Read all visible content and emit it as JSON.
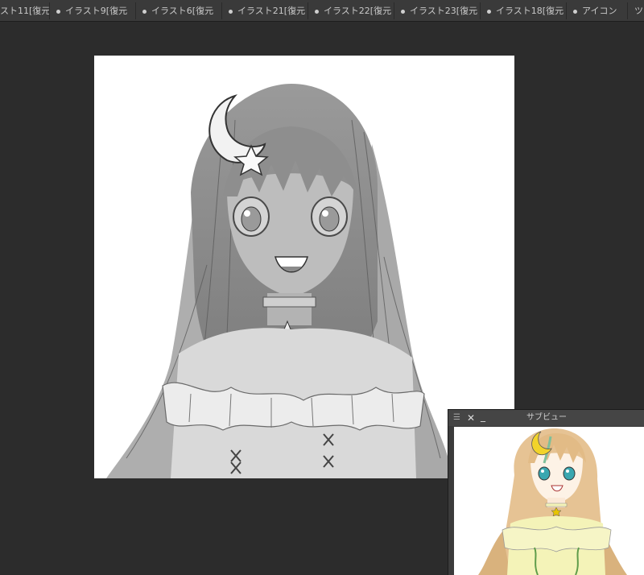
{
  "tabs": [
    {
      "label": "スト11[復元",
      "dot": false
    },
    {
      "label": "イラスト9[復元",
      "dot": true
    },
    {
      "label": "イラスト6[復元",
      "dot": true
    },
    {
      "label": "イラスト21[復元",
      "dot": true
    },
    {
      "label": "イラスト22[復元",
      "dot": true
    },
    {
      "label": "イラスト23[復元",
      "dot": true
    },
    {
      "label": "イラスト18[復元",
      "dot": true
    },
    {
      "label": "アイコン",
      "dot": true
    },
    {
      "label": "ツイ",
      "dot": false
    }
  ],
  "canvas": {
    "description_icon": "illustration-canvas"
  },
  "subview": {
    "title": "サブビュー",
    "menu_icon": "hamburger-icon",
    "close_icon": "close-icon",
    "minimize_icon": "minimize-icon",
    "menu_glyph": "☰",
    "close_glyph": "✕",
    "minimize_glyph": "_"
  },
  "colors": {
    "background": "#2c2c2c",
    "tabbar": "#3a3a3a",
    "subview_bar": "#454545",
    "dress_yellow": "#f4f3b8",
    "hair_blonde": "#e6c394"
  }
}
